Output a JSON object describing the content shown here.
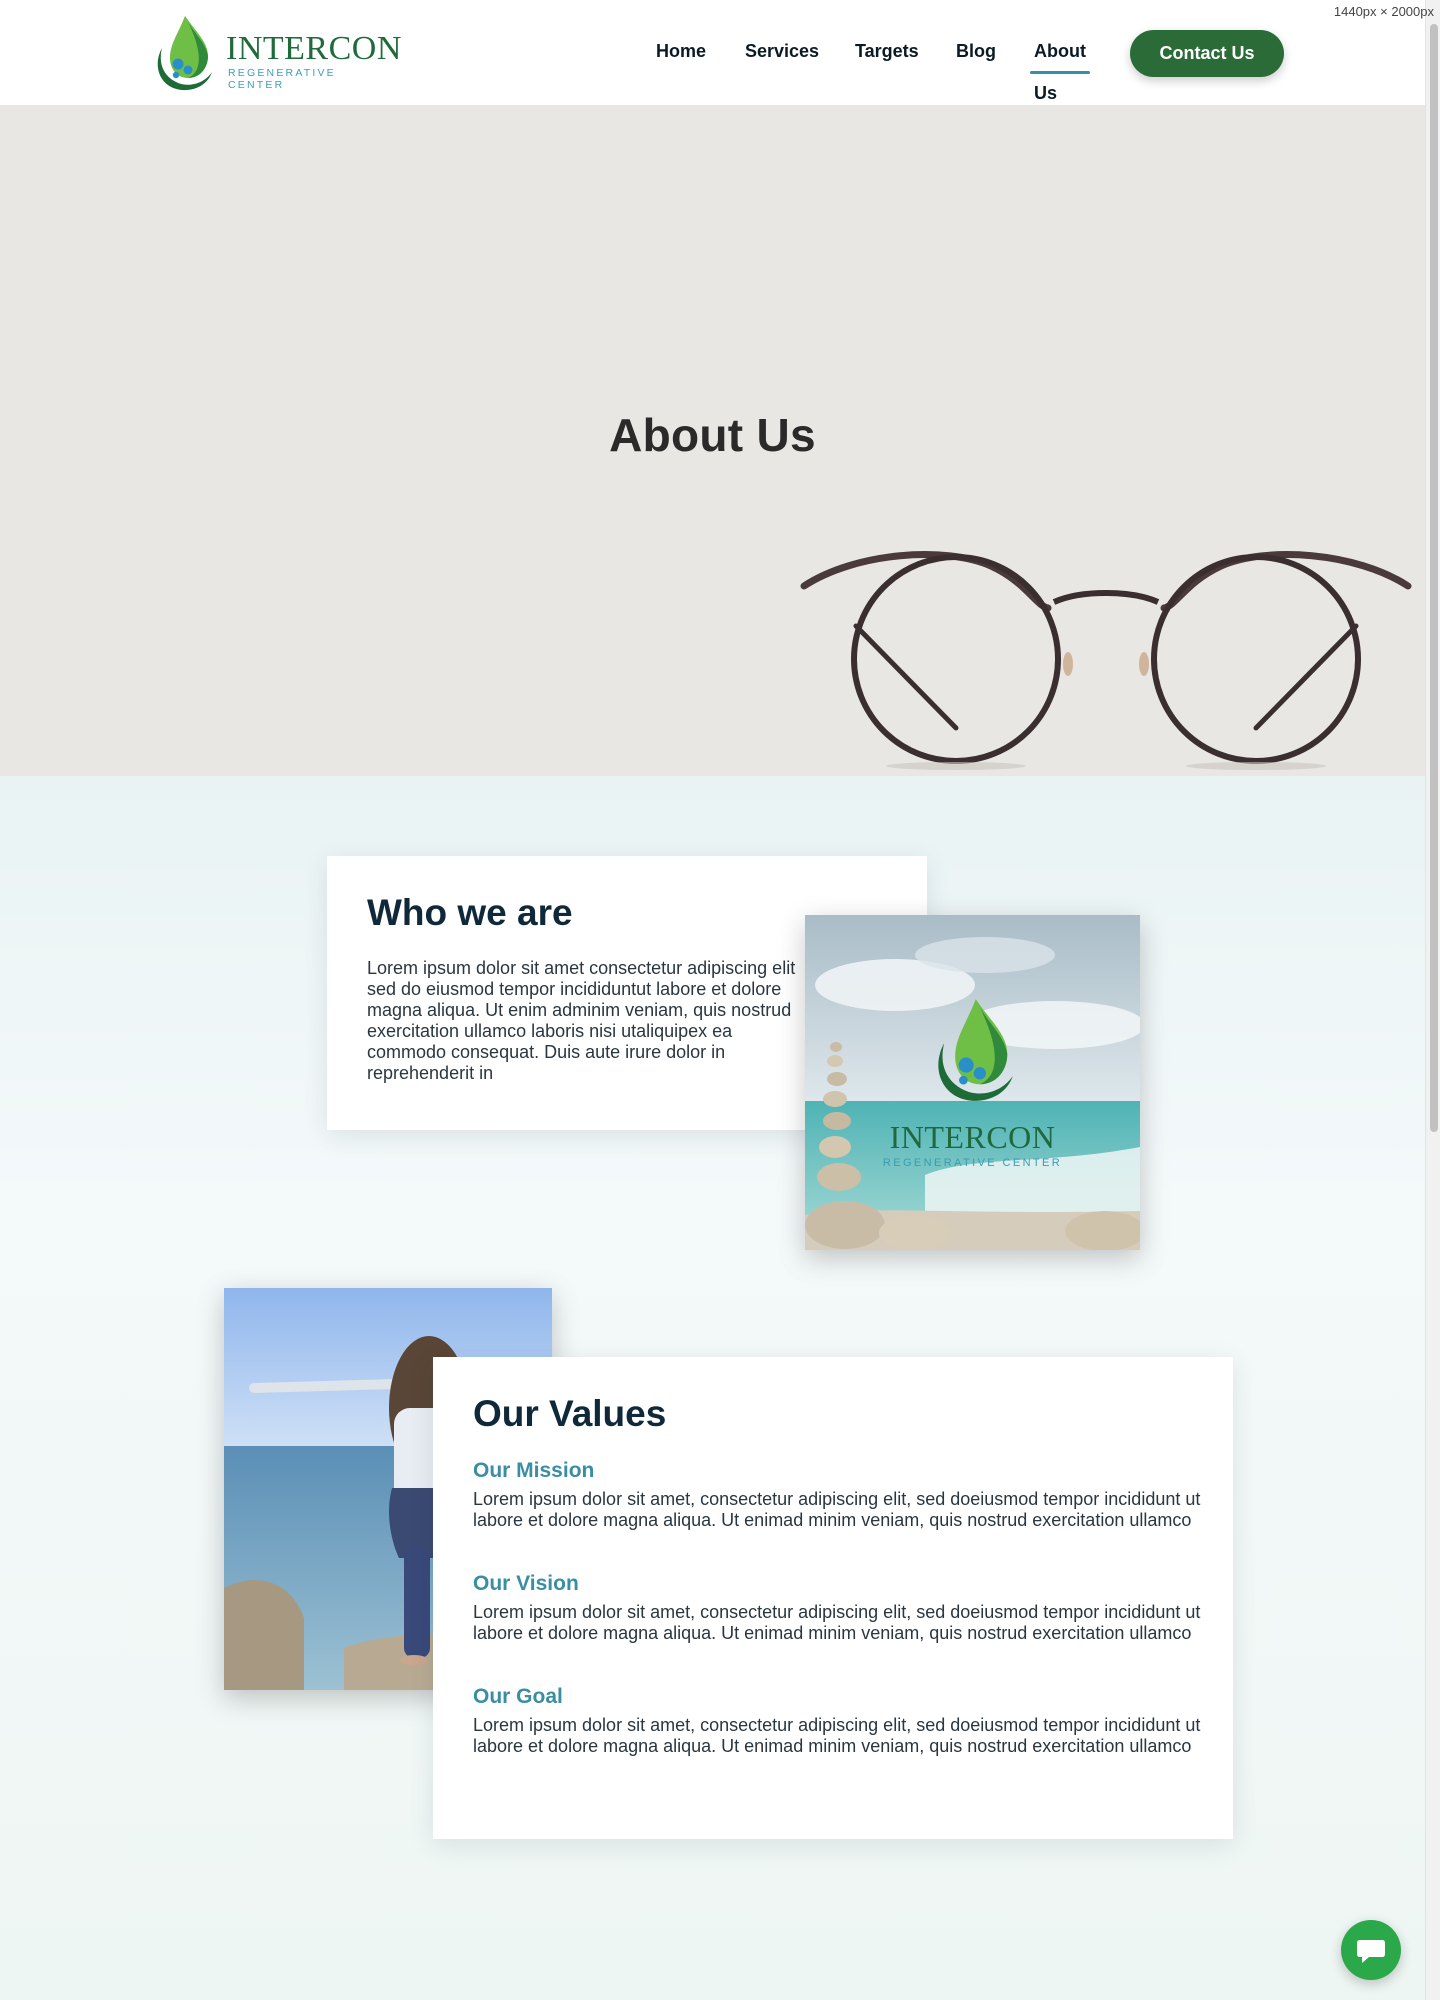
{
  "viewport_label": "1440px × 2000px",
  "header": {
    "brand": "INTERCON",
    "tagline": "REGENERATIVE CENTER",
    "nav": [
      "Home",
      "Services",
      "Targets",
      "Blog",
      "About Us"
    ],
    "active_nav": "About Us",
    "contact_label": "Contact Us"
  },
  "hero": {
    "title": "About Us"
  },
  "who": {
    "title": "Who we are",
    "body": "Lorem ipsum dolor sit amet consectetur adipiscing elit sed do eiusmod tempor incididuntut labore et dolore magna aliqua. Ut enim adminim veniam, quis nostrud exercitation ullamco laboris nisi utaliquipex ea commodo consequat. Duis aute irure dolor in reprehenderit in"
  },
  "beach_card": {
    "brand": "INTERCON",
    "tagline": "REGENERATIVE CENTER"
  },
  "values": {
    "title": "Our Values",
    "items": [
      {
        "title": "Our Mission",
        "text": "Lorem ipsum dolor sit amet, consectetur adipiscing elit, sed doeiusmod tempor incididunt ut labore et dolore magna aliqua. Ut enimad minim veniam, quis nostrud exercitation ullamco"
      },
      {
        "title": "Our Vision",
        "text": "Lorem ipsum dolor sit amet, consectetur adipiscing elit, sed doeiusmod tempor incididunt ut labore et dolore magna aliqua. Ut enimad minim veniam, quis nostrud exercitation ullamco"
      },
      {
        "title": "Our Goal",
        "text": "Lorem ipsum dolor sit amet, consectetur adipiscing elit, sed doeiusmod tempor incididunt ut labore et dolore magna aliqua. Ut enimad minim veniam, quis nostrud exercitation ullamco"
      }
    ]
  },
  "icons": {
    "logo": "intercon-drop-logo-icon",
    "chat": "chat-bubble-icon",
    "hero_image": "eyeglasses-image"
  },
  "colors": {
    "brand_green": "#2a6b37",
    "accent_teal": "#3a8ea3",
    "heading_navy": "#10293a",
    "chat_green": "#2aa84a"
  }
}
